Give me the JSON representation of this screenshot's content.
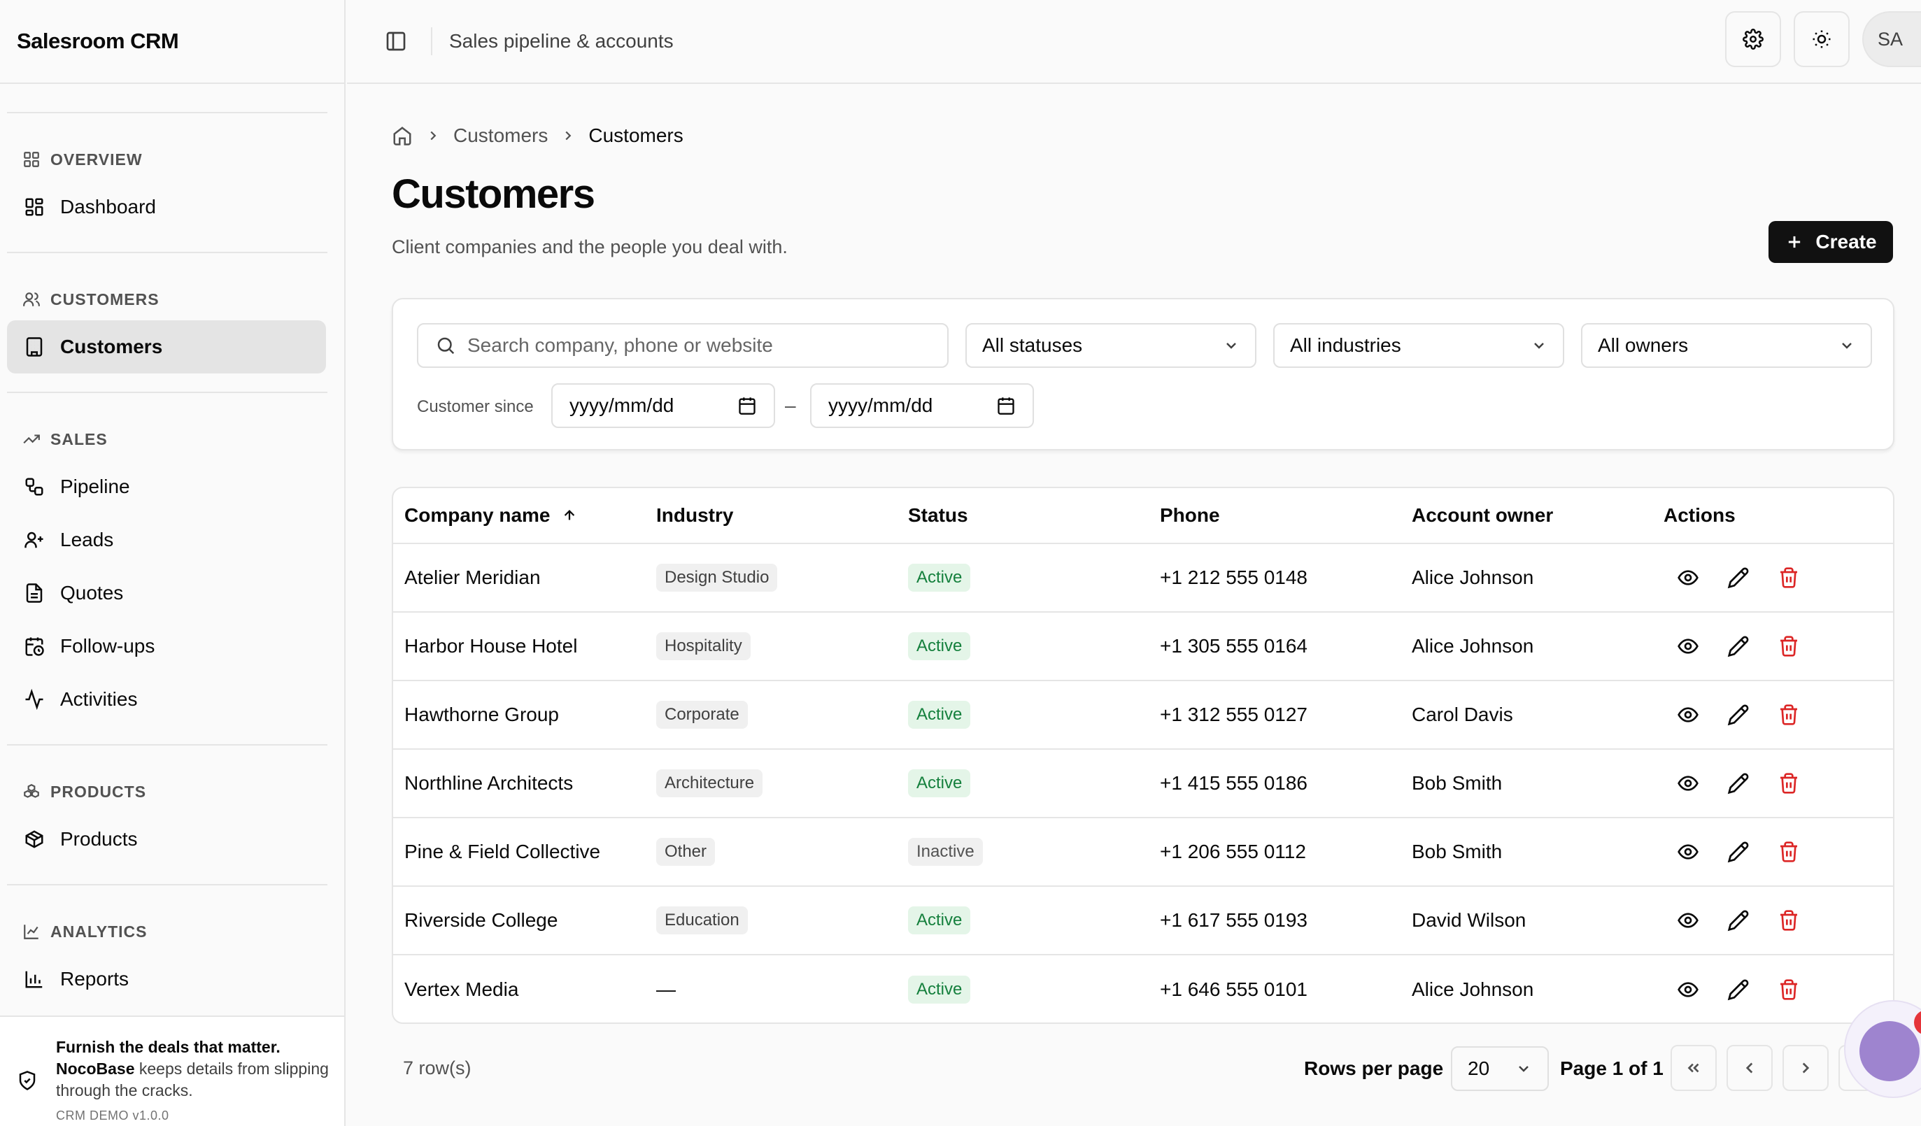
{
  "app": {
    "title": "Salesroom CRM"
  },
  "topbar": {
    "title": "Sales pipeline & accounts",
    "avatar": "SA"
  },
  "sidebar": {
    "groups": [
      {
        "label": "OVERVIEW",
        "items": [
          {
            "label": "Dashboard"
          }
        ]
      },
      {
        "label": "CUSTOMERS",
        "items": [
          {
            "label": "Customers",
            "active": true
          }
        ]
      },
      {
        "label": "SALES",
        "items": [
          {
            "label": "Pipeline"
          },
          {
            "label": "Leads"
          },
          {
            "label": "Quotes"
          },
          {
            "label": "Follow-ups"
          },
          {
            "label": "Activities"
          }
        ]
      },
      {
        "label": "PRODUCTS",
        "items": [
          {
            "label": "Products"
          }
        ]
      },
      {
        "label": "ANALYTICS",
        "items": [
          {
            "label": "Reports"
          }
        ]
      }
    ],
    "promo": {
      "title": "Furnish the deals that matter.",
      "brand": "NocoBase",
      "text": " keeps details from slipping through the cracks.",
      "version": "CRM DEMO v1.0.0"
    }
  },
  "breadcrumb": {
    "items": [
      "Customers",
      "Customers"
    ]
  },
  "page": {
    "title": "Customers",
    "description": "Client companies and the people you deal with.",
    "create_label": "Create"
  },
  "filters": {
    "search_placeholder": "Search company, phone or website",
    "status": "All statuses",
    "industry": "All industries",
    "owner": "All owners",
    "since_label": "Customer since",
    "date_from_placeholder": "yyyy/mm/dd",
    "date_separator": "–",
    "date_to_placeholder": "yyyy/mm/dd"
  },
  "table": {
    "columns": [
      "Company name",
      "Industry",
      "Status",
      "Phone",
      "Account owner",
      "Actions"
    ],
    "rows": [
      {
        "company": "Atelier Meridian",
        "industry": "Design Studio",
        "status": "Active",
        "phone": "+1 212 555 0148",
        "owner": "Alice Johnson"
      },
      {
        "company": "Harbor House Hotel",
        "industry": "Hospitality",
        "status": "Active",
        "phone": "+1 305 555 0164",
        "owner": "Alice Johnson"
      },
      {
        "company": "Hawthorne Group",
        "industry": "Corporate",
        "status": "Active",
        "phone": "+1 312 555 0127",
        "owner": "Carol Davis"
      },
      {
        "company": "Northline Architects",
        "industry": "Architecture",
        "status": "Active",
        "phone": "+1 415 555 0186",
        "owner": "Bob Smith"
      },
      {
        "company": "Pine & Field Collective",
        "industry": "Other",
        "status": "Inactive",
        "phone": "+1 206 555 0112",
        "owner": "Bob Smith"
      },
      {
        "company": "Riverside College",
        "industry": "Education",
        "status": "Active",
        "phone": "+1 617 555 0193",
        "owner": "David Wilson"
      },
      {
        "company": "Vertex Media",
        "industry": "—",
        "status": "Active",
        "phone": "+1 646 555 0101",
        "owner": "Alice Johnson"
      }
    ]
  },
  "pagination": {
    "row_count": "7 row(s)",
    "rows_per_page_label": "Rows per page",
    "rows_per_page": "20",
    "page_info": "Page 1 of 1"
  },
  "help": {
    "badge": "1"
  },
  "colors": {
    "primary": "#111111",
    "active_bg": "#e4f5e8",
    "active_text": "#15803d",
    "danger": "#dc2626"
  }
}
